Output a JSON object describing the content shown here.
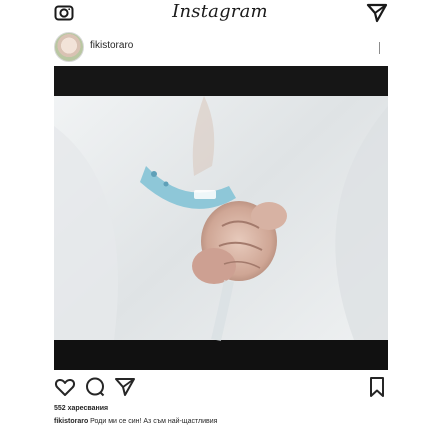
{
  "app": {
    "brand": "Instagram"
  },
  "icons": {
    "camera": "camera-icon",
    "direct": "send-icon",
    "like": "heart-icon",
    "comment": "comment-icon",
    "share": "send-icon",
    "save": "bookmark-icon"
  },
  "post": {
    "username": "fikistoraro",
    "photo_description_colors": {
      "blanket": "#eceeef",
      "wristband": "#8ec7d8",
      "skin": "#d8b5a6"
    },
    "likes_text": "552 харесвания",
    "caption_user": "fikistoraro",
    "caption_text": " Роди ми се син! Аз съм най-щастливия"
  },
  "colors": {
    "background": "#ffffff",
    "text": "#262626",
    "photo_bg": "#e9ebec"
  }
}
